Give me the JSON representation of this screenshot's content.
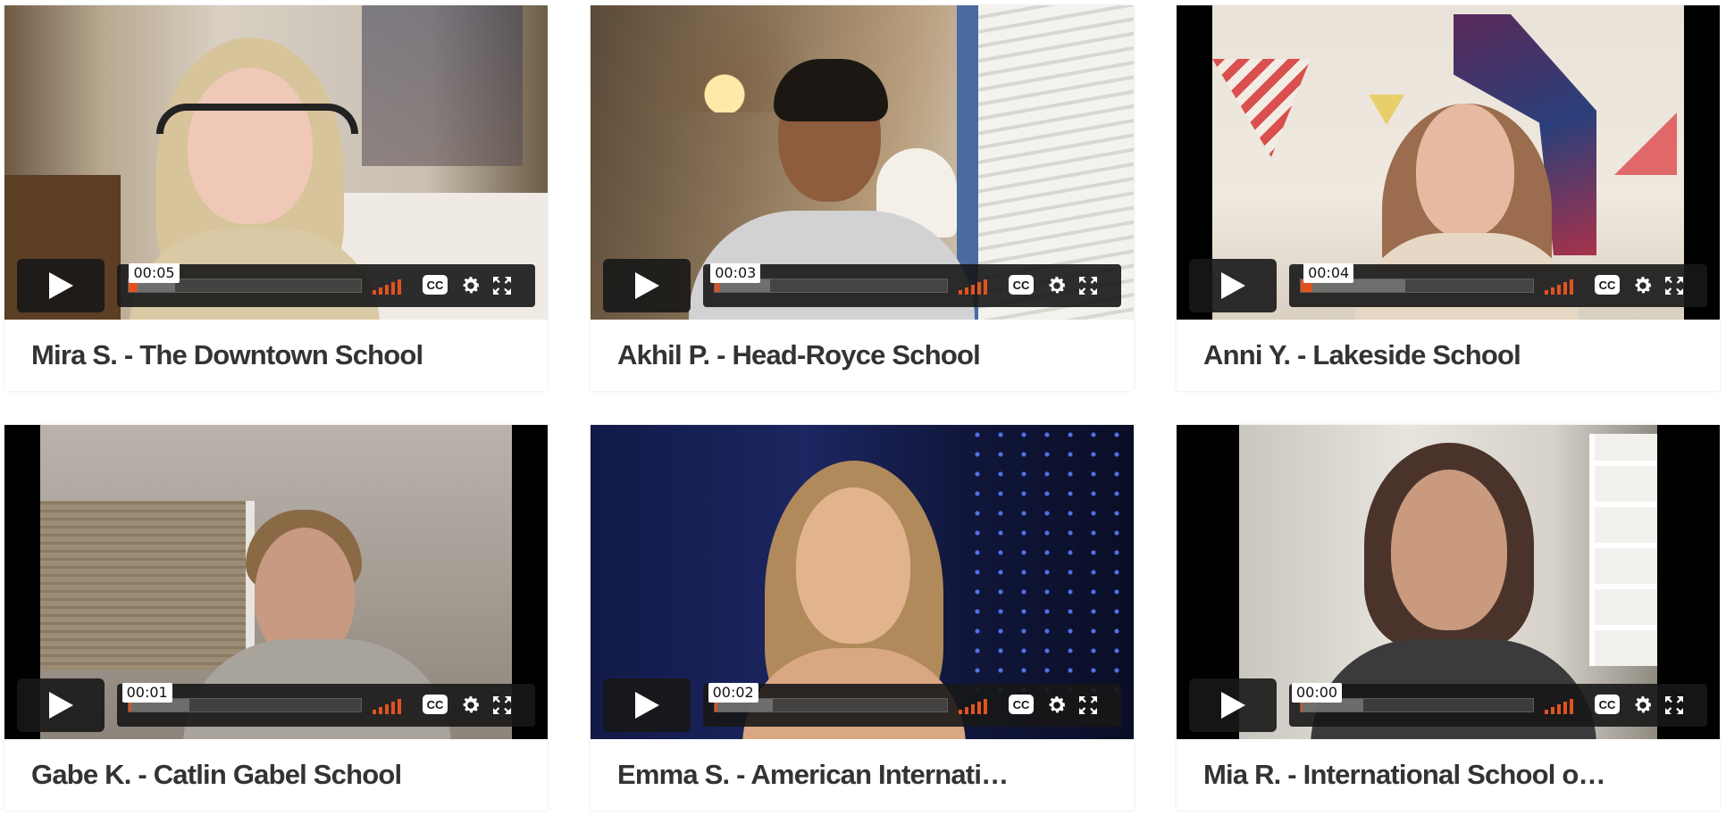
{
  "videos": [
    {
      "caption": "Mira S. - The Downtown School",
      "time": "00:05",
      "played_fraction": 0.04,
      "loaded_fraction": 0.2
    },
    {
      "caption": "Akhil P. - Head-Royce School",
      "time": "00:03",
      "played_fraction": 0.02,
      "loaded_fraction": 0.24
    },
    {
      "caption": "Anni Y. - Lakeside School",
      "time": "00:04",
      "played_fraction": 0.05,
      "loaded_fraction": 0.45
    },
    {
      "caption": "Gabe K. - Catlin Gabel School",
      "time": "00:01",
      "played_fraction": 0.01,
      "loaded_fraction": 0.26
    },
    {
      "caption": "Emma S. - American Internati…",
      "time": "00:02",
      "played_fraction": 0.01,
      "loaded_fraction": 0.25
    },
    {
      "caption": "Mia R. - International School o…",
      "time": "00:00",
      "played_fraction": 0.0,
      "loaded_fraction": 0.27
    }
  ],
  "controls": {
    "cc_label": "CC",
    "play_icon": "play-icon",
    "volume_icon": "volume-bars-icon",
    "settings_icon": "gear-icon",
    "fullscreen_icon": "fullscreen-icon"
  },
  "colors": {
    "accent": "#e0531f",
    "control_bg": "#171717",
    "caption_text": "#333333"
  }
}
